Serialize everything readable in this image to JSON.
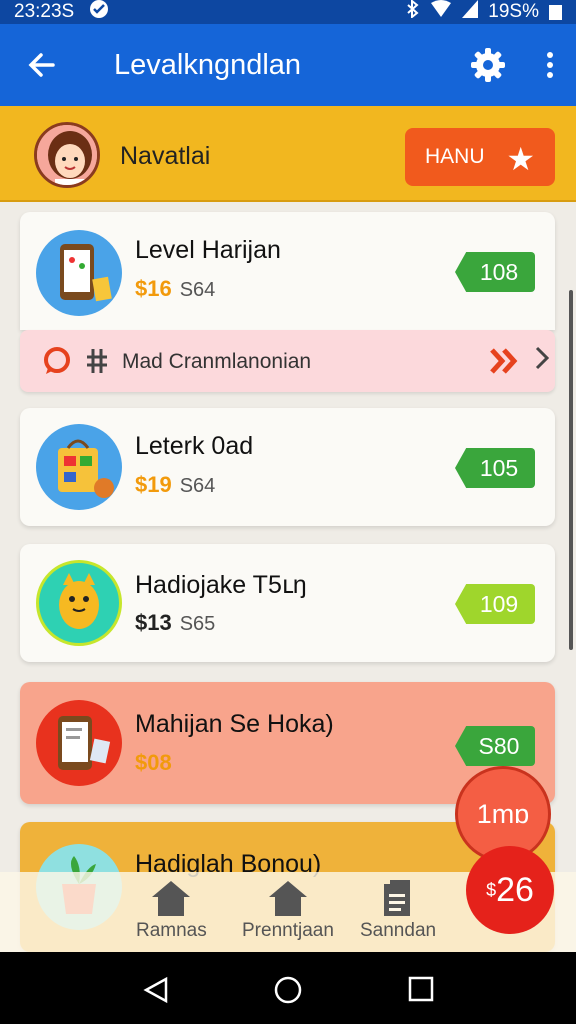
{
  "status_bar": {
    "time": "23:23S",
    "battery": "19S%"
  },
  "app_bar": {
    "title": "Levalkngndlan"
  },
  "profile": {
    "name": "Navatlai",
    "button_label": "HANU"
  },
  "promo": {
    "label": "Mad Cranmlanonian"
  },
  "items": [
    {
      "title": "Level Harijan",
      "price": "$16",
      "old_price": "S64",
      "badge": "108",
      "price_color": "#f29a0c",
      "badge_color": "#3aa63c"
    },
    {
      "title": "Leterk 0ad",
      "price": "$19",
      "old_price": "S64",
      "badge": "105",
      "price_color": "#f29a0c",
      "badge_color": "#3aa63c"
    },
    {
      "title": "Hadiojake T5ւŋ",
      "price": "$13",
      "old_price": "S65",
      "badge": "109",
      "price_color": "#222222",
      "badge_color": "#9fd62c"
    },
    {
      "title": "Mahijan Se  Hoka)",
      "price": "$08",
      "old_price": "",
      "badge": "S80",
      "price_color": "#f29a0c",
      "badge_color": "#3aa63c"
    },
    {
      "title": "Hadiglah Bonou)",
      "price": "",
      "old_price": "",
      "badge": "",
      "price_color": "#555555",
      "badge_color": ""
    }
  ],
  "fab_secondary": {
    "label": "1mɒ"
  },
  "fab_primary": {
    "currency": "$",
    "value": "26"
  },
  "bottom_nav": [
    {
      "label": "Ramnas",
      "icon": "home-icon"
    },
    {
      "label": "Prenntjaan",
      "icon": "home-icon"
    },
    {
      "label": "Sanndan",
      "icon": "document-icon"
    }
  ],
  "colors": {
    "app_bar": "#1565d8",
    "profile_bar": "#f2b71f",
    "accent": "#f15a1d"
  }
}
